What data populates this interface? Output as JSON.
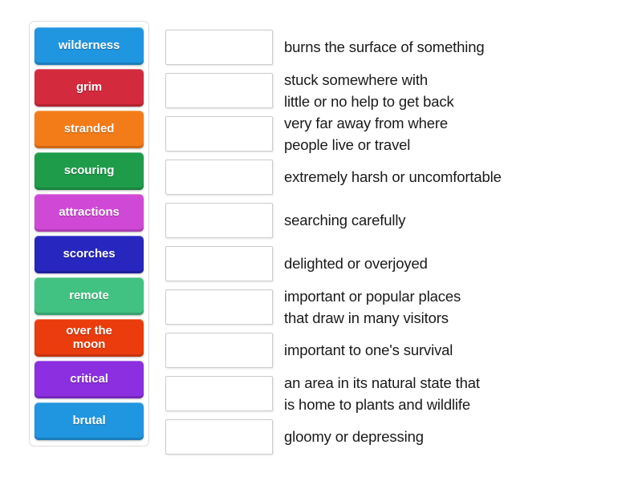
{
  "activity": {
    "type": "match-up",
    "tiles_panel_name": "word-tiles-panel"
  },
  "tiles": [
    {
      "label": "wilderness",
      "color": "#2196e0"
    },
    {
      "label": "grim",
      "color": "#d42a3d"
    },
    {
      "label": "stranded",
      "color": "#f47c18"
    },
    {
      "label": "scouring",
      "color": "#1e9c4a"
    },
    {
      "label": "attractions",
      "color": "#d049d6"
    },
    {
      "label": "scorches",
      "color": "#2727bf"
    },
    {
      "label": "remote",
      "color": "#42c282"
    },
    {
      "label": "over the\nmoon",
      "color": "#ea3c0c"
    },
    {
      "label": "critical",
      "color": "#8b2fe0"
    },
    {
      "label": "brutal",
      "color": "#2196e0"
    }
  ],
  "rows": [
    {
      "dropbox_value": "",
      "definition": "burns the surface of something"
    },
    {
      "dropbox_value": "",
      "definition": "stuck somewhere with\nlittle or no help to get back"
    },
    {
      "dropbox_value": "",
      "definition": "very far away from where\npeople live or travel"
    },
    {
      "dropbox_value": "",
      "definition": "extremely harsh or uncomfortable"
    },
    {
      "dropbox_value": "",
      "definition": "searching carefully"
    },
    {
      "dropbox_value": "",
      "definition": "delighted or overjoyed"
    },
    {
      "dropbox_value": "",
      "definition": "important or popular places\nthat draw in many visitors"
    },
    {
      "dropbox_value": "",
      "definition": "important to one's survival"
    },
    {
      "dropbox_value": "",
      "definition": "an area in its natural state that\nis home to plants and wildlife"
    },
    {
      "dropbox_value": "",
      "definition": "gloomy or depressing"
    }
  ],
  "colors": {
    "page_background": "#ffffff",
    "panel_border": "#dcdcdc",
    "dropbox_border": "#cccccc",
    "definition_text": "#1a1a1a",
    "tile_text": "#ffffff"
  }
}
